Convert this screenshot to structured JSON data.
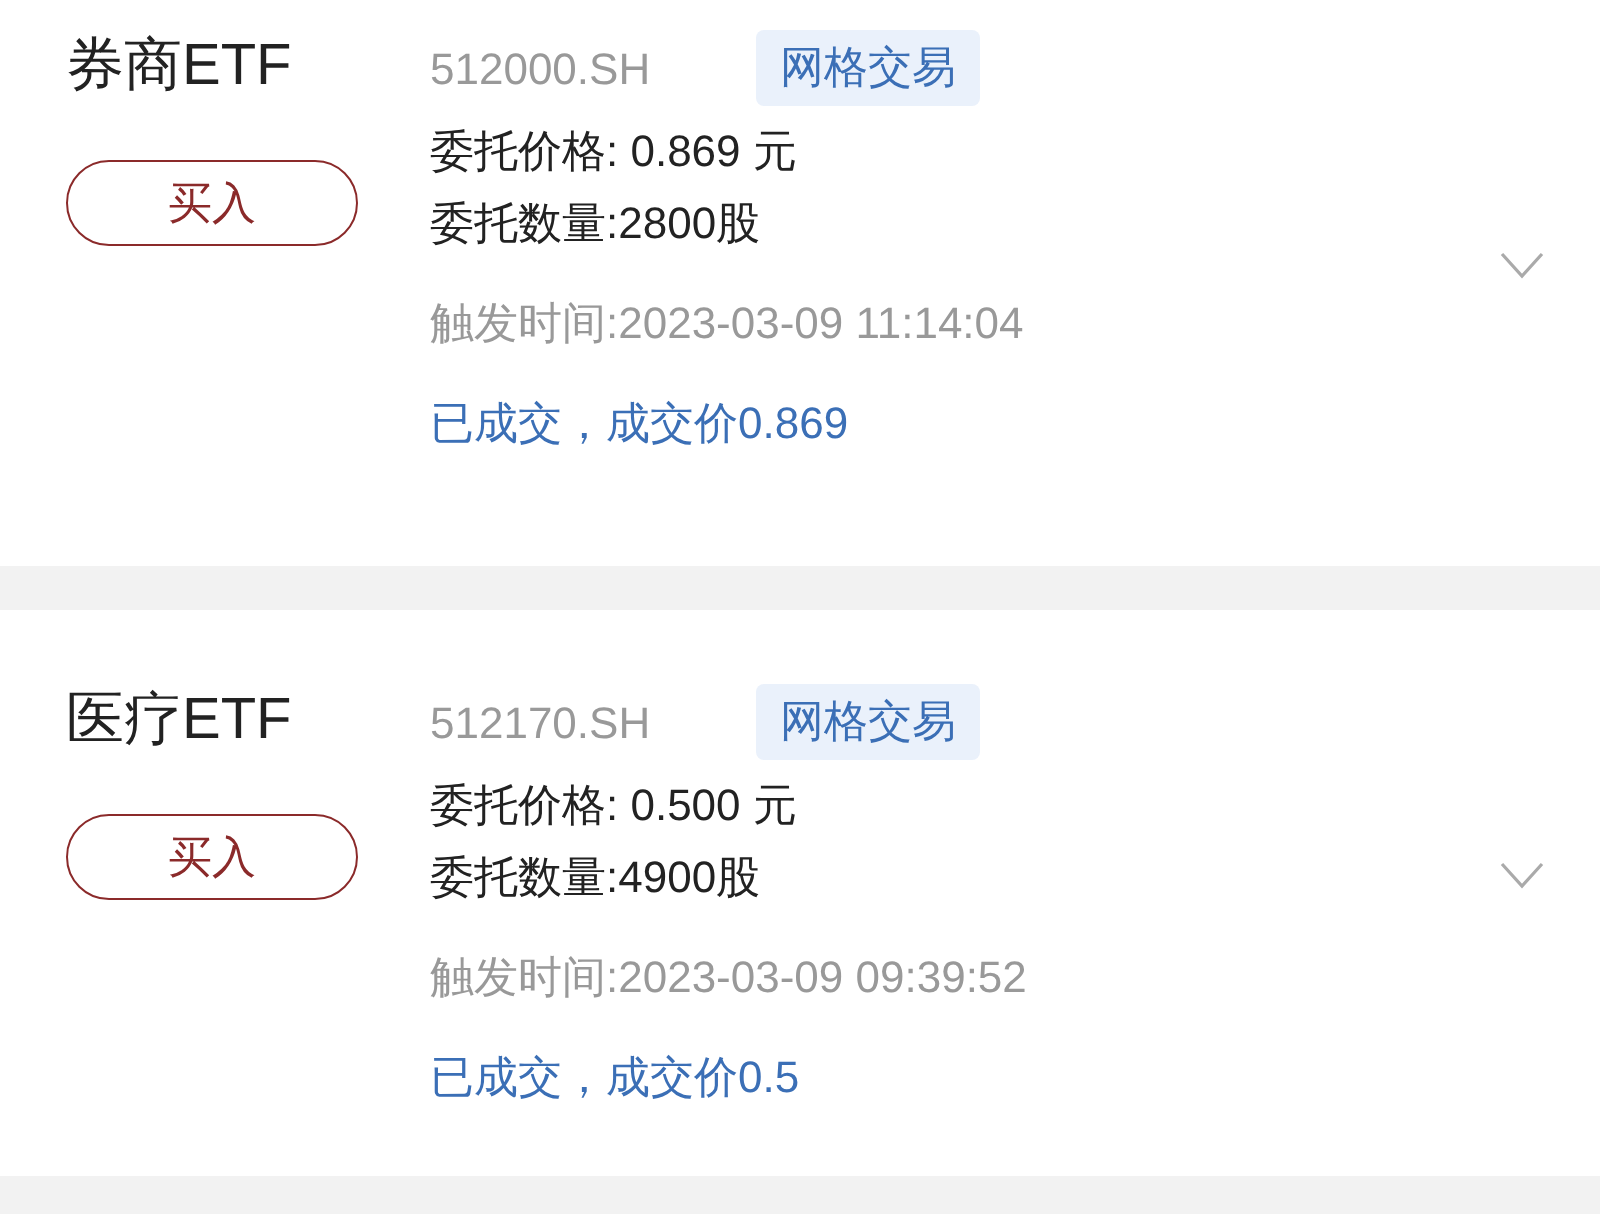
{
  "orders": [
    {
      "name": "券商ETF",
      "code": "512000.SH",
      "tag": "网格交易",
      "action": "买入",
      "price_line": "委托价格: 0.869 元",
      "qty_line": "委托数量:2800股",
      "time_line": "触发时间:2023-03-09 11:14:04",
      "status": "已成交，成交价0.869",
      "expanded": false
    },
    {
      "name": "医疗ETF",
      "code": "512170.SH",
      "tag": "网格交易",
      "action": "买入",
      "price_line": "委托价格: 0.500 元",
      "qty_line": "委托数量:4900股",
      "time_line": "触发时间:2023-03-09 09:39:52",
      "status": "已成交，成交价0.5",
      "expanded": false
    }
  ]
}
